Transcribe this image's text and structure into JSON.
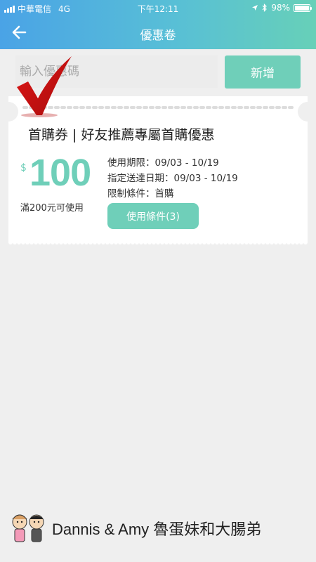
{
  "status_bar": {
    "carrier": "中華電信",
    "network": "4G",
    "time": "下午12:11",
    "battery": "98%",
    "battery_level": 0.98
  },
  "nav": {
    "title": "優惠卷",
    "back_icon": "arrow-left-icon"
  },
  "code_entry": {
    "placeholder": "輸入優惠碼",
    "add_label": "新增"
  },
  "coupon": {
    "title": "首購券 | 好友推薦專屬首購優惠",
    "currency": "$",
    "amount": "100",
    "min_spend": "滿200元可使用",
    "validity": "使用期限：09/03 - 10/19",
    "delivery_dates": "指定送達日期：09/03 - 10/19",
    "restriction": "限制條件：首購",
    "conditions_button": "使用條件(3)",
    "accent_color": "#6fcfb9"
  },
  "watermark": {
    "text": "Dannis & Amy 魯蛋妹和大腸弟"
  }
}
